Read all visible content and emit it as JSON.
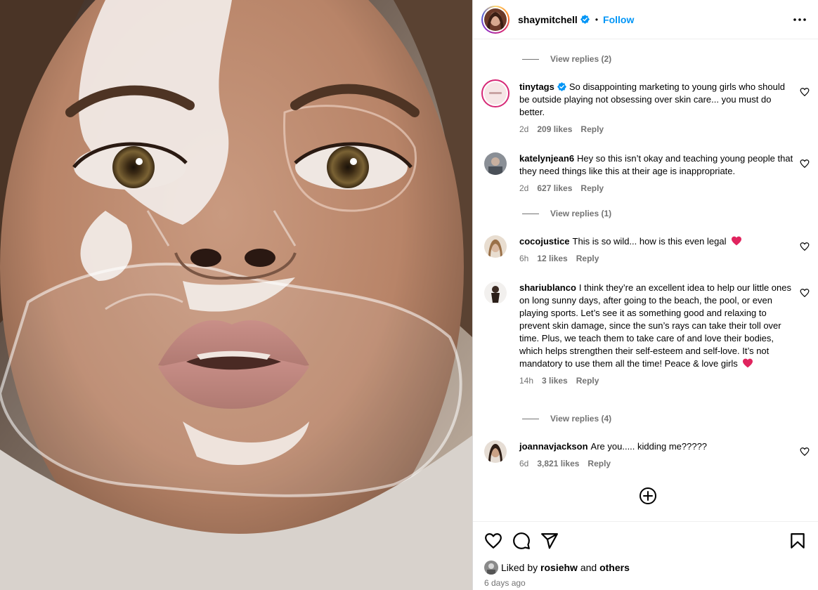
{
  "header": {
    "username": "shaymitchell",
    "separator": "•",
    "follow_label": "Follow",
    "more_icon": "more-horizontal-icon"
  },
  "view_replies": [
    "View replies (2)",
    "View replies (1)",
    "View replies (4)"
  ],
  "comments": [
    {
      "username": "tinytags",
      "verified": true,
      "text": "So disappointing marketing to young girls who should be outside playing not obsessing over skin care... you must do better.",
      "age": "2d",
      "likes": "209 likes",
      "reply": "Reply"
    },
    {
      "username": "katelynjean6",
      "text": "Hey so this isn’t okay and teaching young people that they need things like this at their age is inappropriate.",
      "age": "2d",
      "likes": "627 likes",
      "reply": "Reply"
    },
    {
      "username": "cocojustice",
      "text": "This is so wild... how is this even legal",
      "emoji": "heart",
      "age": "6h",
      "likes": "12 likes",
      "reply": "Reply"
    },
    {
      "username": "shariublanco",
      "text": "I think they’re an excellent idea to help our little ones on long sunny days, after going to the beach, the pool, or even playing sports. Let’s see it as something good and relaxing to prevent skin damage, since the sun’s rays can take their toll over time. Plus, we teach them to take care of and love their bodies, which helps strengthen their self-esteem and self-love. It’s not mandatory to use them all the time! Peace & love girls",
      "emoji": "heart",
      "age": "14h",
      "likes": "3 likes",
      "reply": "Reply"
    },
    {
      "username": "joannavjackson",
      "text": "Are you..... kidding me?????",
      "age": "6d",
      "likes": "3,821 likes",
      "reply": "Reply"
    }
  ],
  "actions": {
    "icons": [
      "heart-icon",
      "comment-icon",
      "share-icon",
      "bookmark-icon"
    ],
    "liked_prefix": "Liked by",
    "liked_user": "rosiehw",
    "liked_and": "and",
    "liked_others": "others",
    "timestamp": "6 days ago"
  },
  "colors": {
    "accent": "#0095f6",
    "verified": "#0095f6",
    "secondary_text": "#737373",
    "heart_emoji": "#e0245e"
  }
}
